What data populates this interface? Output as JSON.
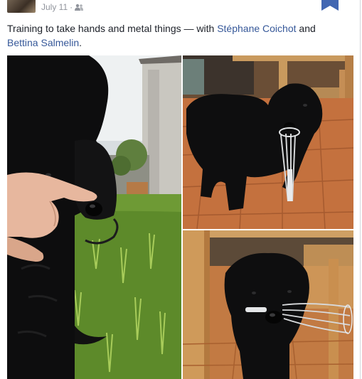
{
  "post": {
    "date": "July 11",
    "separator": "·",
    "caption_text": "Training to take hands and metal things — with ",
    "tagged_1": "Stéphane Coichot",
    "connector": " and",
    "tagged_2": "Bettina Salmelin",
    "end": ".",
    "audience_icon": "friends-icon",
    "save_icon": "bookmark-icon"
  },
  "colors": {
    "link": "#365899",
    "meta": "#90949c",
    "text": "#1d2129",
    "bookmark": "#4267b2"
  },
  "photos": [
    {
      "subject": "black puppy held by hand on grass"
    },
    {
      "subject": "black puppy holding metal whisk on tile floor"
    },
    {
      "subject": "black puppy with whisk in mouth indoors"
    }
  ]
}
